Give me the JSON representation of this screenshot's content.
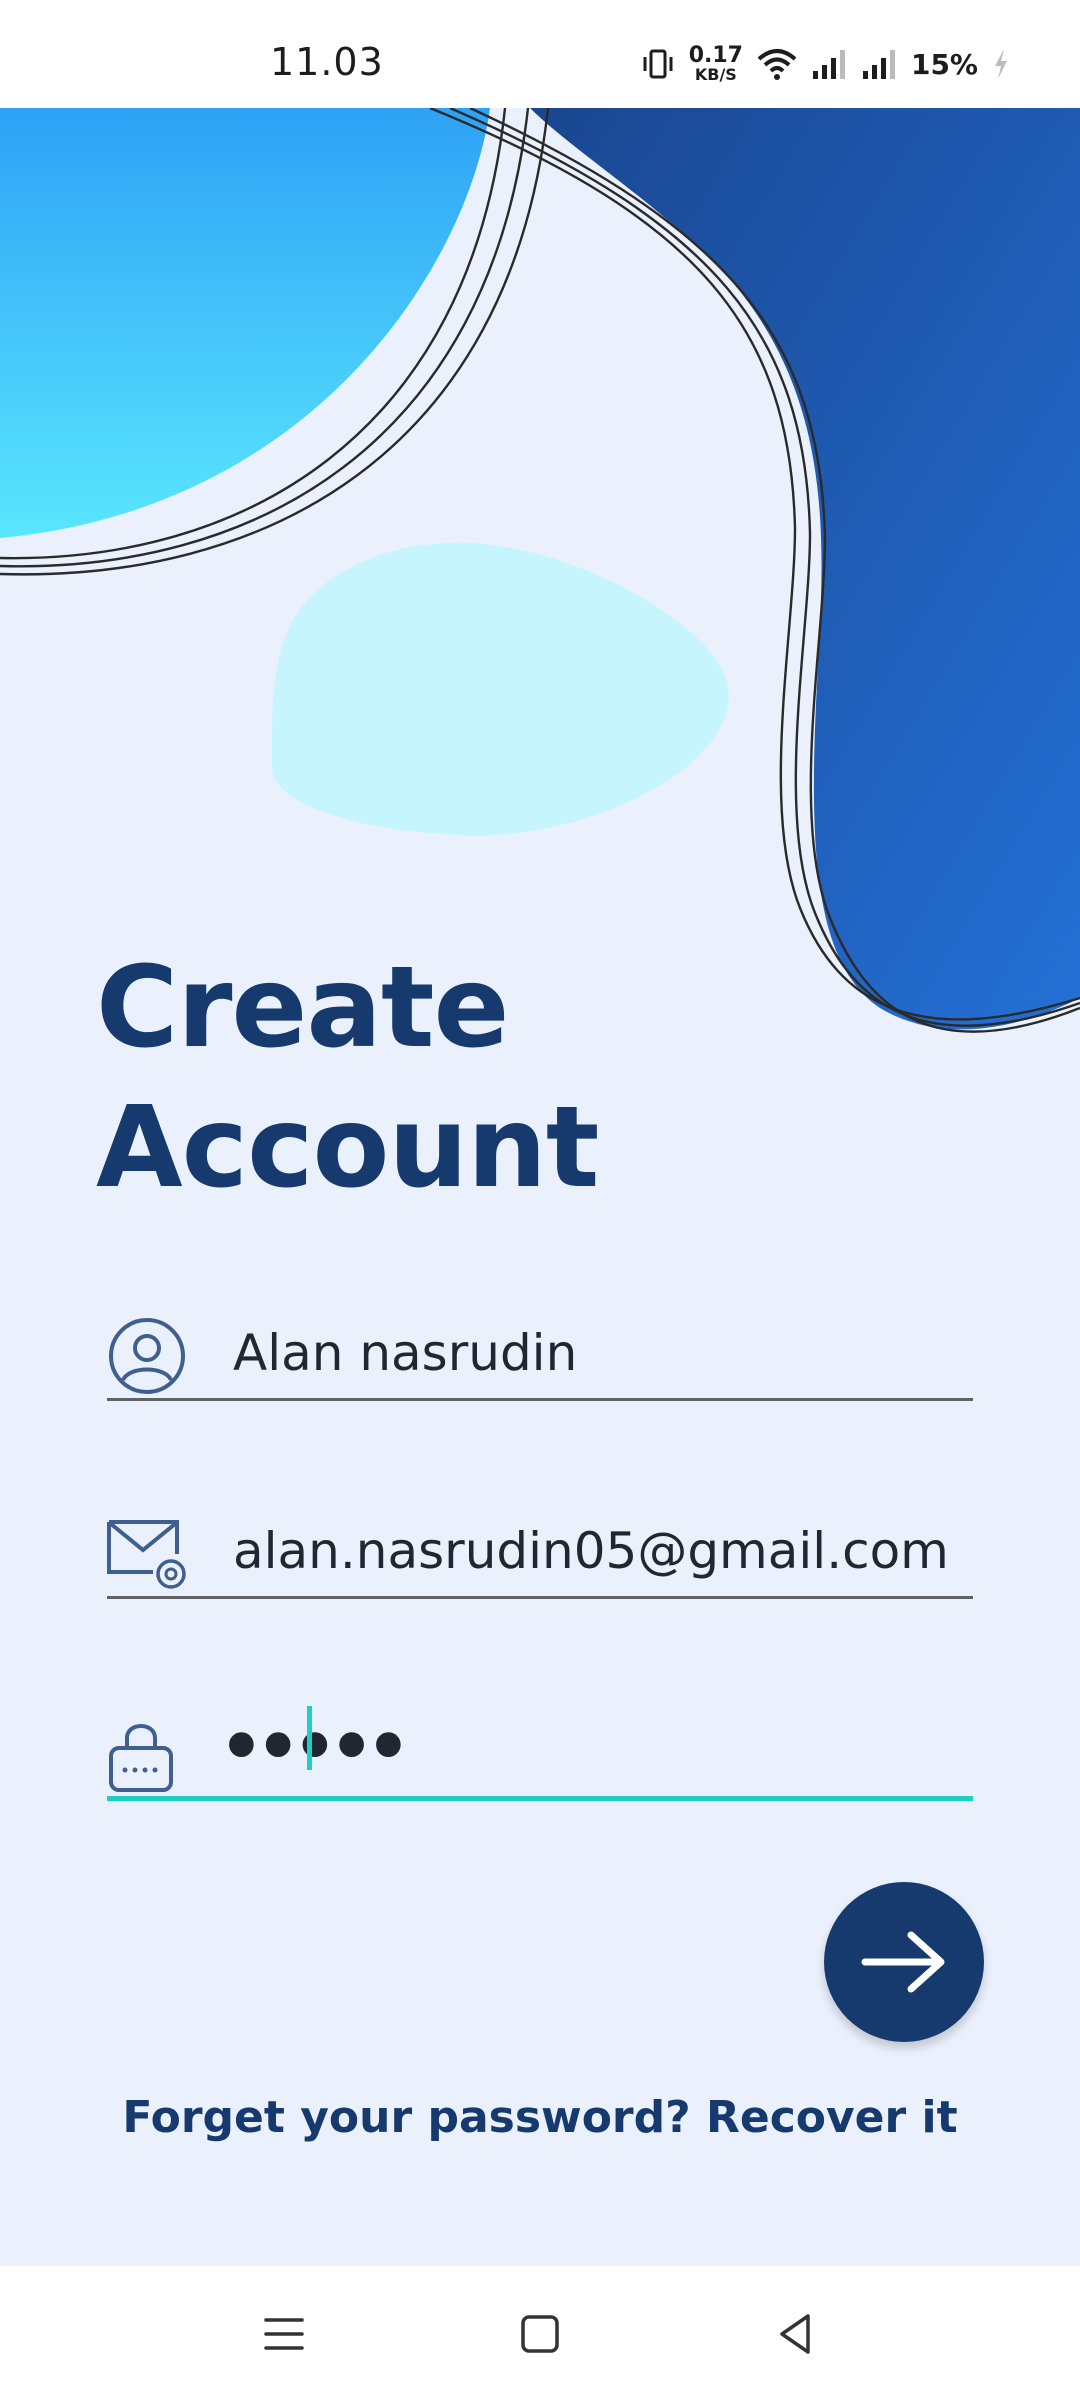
{
  "status_bar": {
    "time": "11.03",
    "net_speed_value": "0.17",
    "net_speed_unit": "KB/S",
    "battery": "15%",
    "icons": [
      "vibrate-icon",
      "wifi-icon",
      "signal-icon",
      "signal-icon",
      "charging-icon"
    ]
  },
  "title": {
    "line1": "Create",
    "line2": "Account"
  },
  "form": {
    "name_value": "Alan nasrudin",
    "email_value": "alan.nasrudin05@gmail.com",
    "password_value": "•••••"
  },
  "links": {
    "recover": "Forget your password? Recover it"
  },
  "colors": {
    "primary": "#163a6e",
    "accent": "#1fcfc1",
    "background": "#eaf0fc",
    "blob_light": "#43c8fb",
    "blob_dark": "#1f5fbf"
  },
  "nav_bar": {
    "icons": [
      "menu-icon",
      "home-square-icon",
      "back-triangle-icon"
    ]
  }
}
